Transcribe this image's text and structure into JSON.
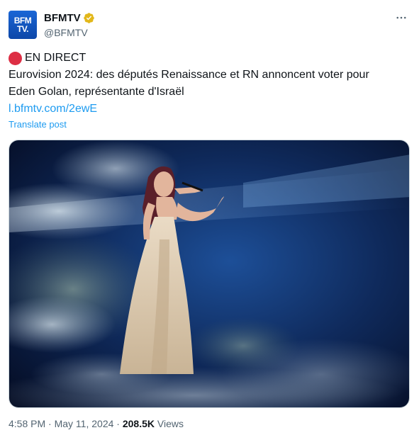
{
  "author": {
    "display_name": "BFMTV",
    "handle": "@BFMTV",
    "avatar_text_line1": "BFM",
    "avatar_text_line2": "TV."
  },
  "post": {
    "live_label": "EN DIRECT",
    "body_line1": "Eurovision 2024: des députés Renaissance et RN annoncent voter pour",
    "body_line2": "Eden Golan, représentante d'Israël",
    "link_text": "l.bfmtv.com/2ewE",
    "translate_label": "Translate post"
  },
  "meta": {
    "time": "4:58 PM",
    "separator": "·",
    "date": "May 11, 2024",
    "views_count": "208.5K",
    "views_label": "Views"
  },
  "icons": {
    "verified": "verified-badge-icon",
    "more": "more-options-icon",
    "live": "red-circle-icon"
  },
  "colors": {
    "accent": "#1d9bf0",
    "verified": "#e2b719",
    "live_dot": "#dd2e44",
    "brand": "#1259c3"
  }
}
